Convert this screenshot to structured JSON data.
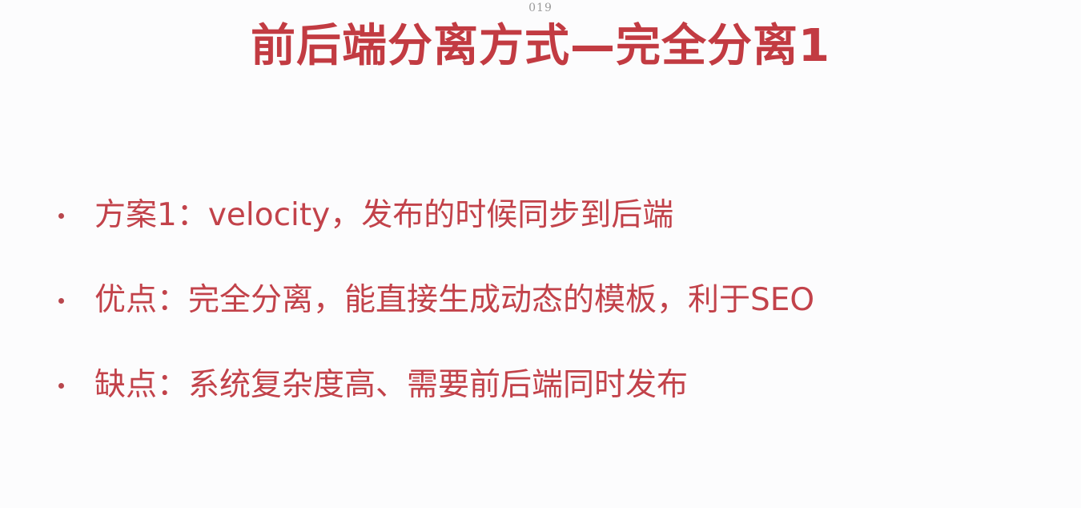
{
  "page_number": "019",
  "title": "前后端分离方式—完全分离1",
  "bullets": [
    "方案1：velocity，发布的时候同步到后端",
    "优点：完全分离，能直接生成动态的模板，利于SEO",
    "缺点：系统复杂度高、需要前后端同时发布"
  ],
  "colors": {
    "title": "#c23b42",
    "text": "#c2424a",
    "background": "#fcfcfd"
  }
}
